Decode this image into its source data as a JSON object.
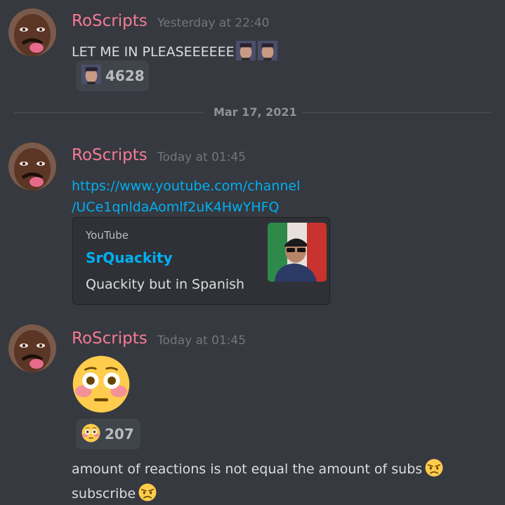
{
  "messages": [
    {
      "username": "RoScripts",
      "timestamp": "Yesterday at 22:40",
      "text": "LET ME IN PLEASEEEEEE",
      "reaction": {
        "emoji": "custom-face-emoji",
        "count": "4628"
      }
    },
    {
      "username": "RoScripts",
      "timestamp": "Today at 01:45",
      "link_line1": "https://www.youtube.com/channel",
      "link_line2": "/UCe1qnldaAomlf2uK4HwYHFQ",
      "embed": {
        "provider": "YouTube",
        "title": "SrQuackity",
        "description": "Quackity but in Spanish"
      }
    },
    {
      "username": "RoScripts",
      "timestamp": "Today at 01:45",
      "big_emoji": "flushed-emoji",
      "reaction": {
        "emoji": "flushed-emoji",
        "count": "207"
      },
      "line1": "amount of reactions is not equal the amount of subs",
      "line2": "subscribe"
    }
  ],
  "divider": {
    "date": "Mar 17, 2021"
  },
  "colors": {
    "background": "#36393f",
    "username": "#f47b94",
    "link": "#00b0f4",
    "timestamp": "#72767d",
    "reaction_bg": "#40444b",
    "embed_bg": "#2f3136"
  }
}
